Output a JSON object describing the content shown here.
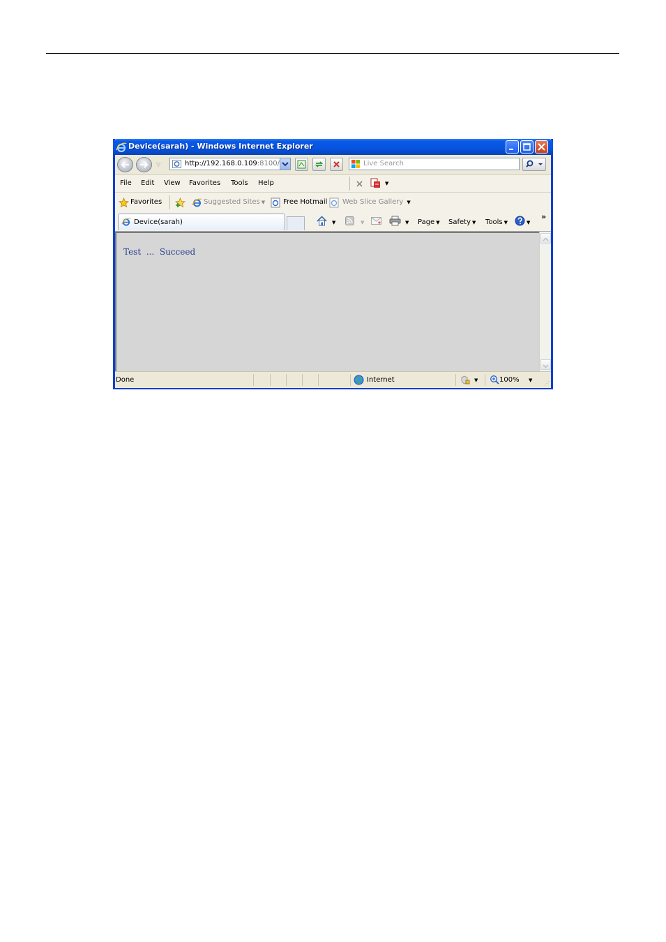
{
  "window": {
    "title": "Device(sarah) - Windows Internet Explorer"
  },
  "address": {
    "url_main": "http://192.168.0.109",
    "url_port": ":8100/"
  },
  "search": {
    "placeholder": "Live Search"
  },
  "menu": {
    "items": [
      "File",
      "Edit",
      "View",
      "Favorites",
      "Tools",
      "Help"
    ]
  },
  "favorites_bar": {
    "favorites_label": "Favorites",
    "suggested_sites": "Suggested Sites",
    "free_hotmail": "Free Hotmail",
    "web_slice_gallery": "Web Slice Gallery"
  },
  "tab": {
    "label": "Device(sarah)"
  },
  "command_bar": {
    "page": "Page",
    "safety": "Safety",
    "tools": "Tools",
    "overflow": "»"
  },
  "content": {
    "message": "Test  ...  Succeed"
  },
  "status": {
    "left": "Done",
    "zone": "Internet",
    "zoom": "100%"
  },
  "colors": {
    "title_bar": "#0654e0",
    "content_bg": "#d6d6d6",
    "content_text": "#2b3f8c"
  }
}
